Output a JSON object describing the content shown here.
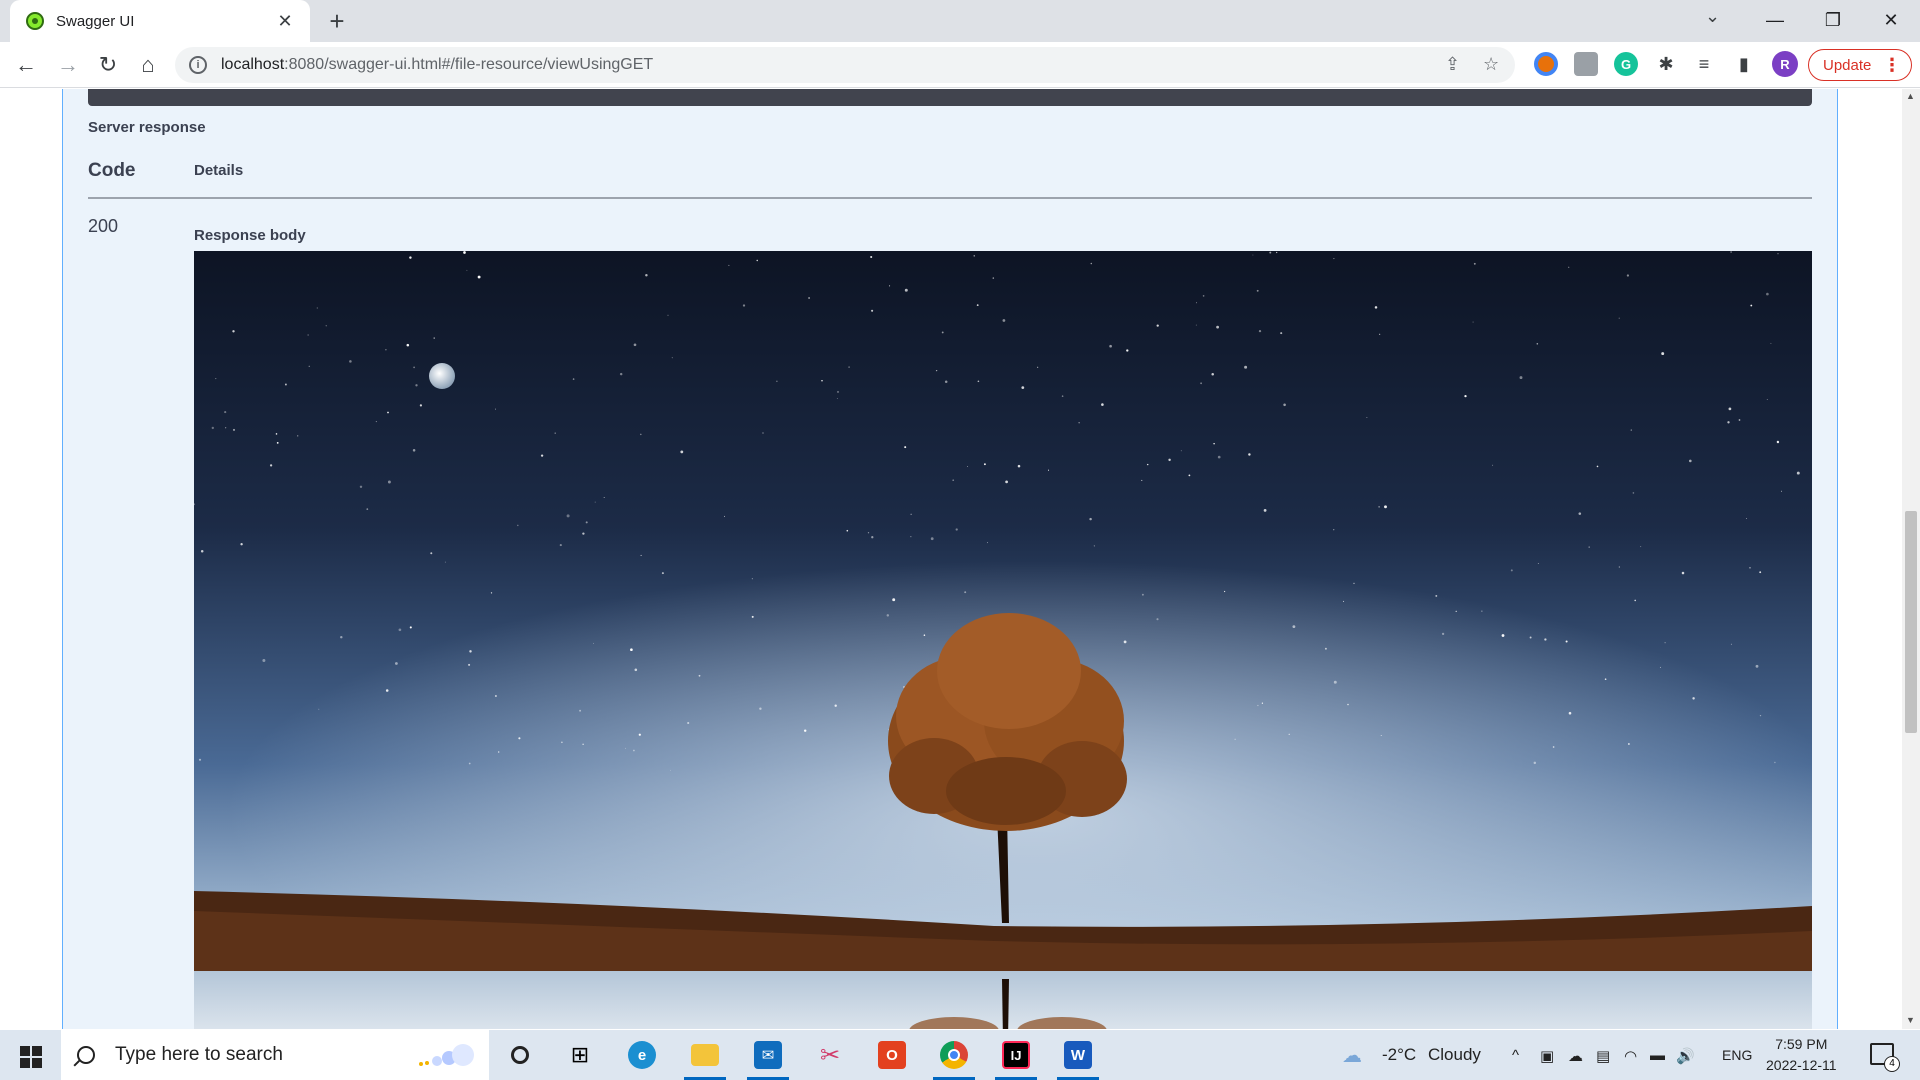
{
  "browser": {
    "tab_title": "Swagger UI",
    "tab_close": "✕",
    "new_tab": "+",
    "url_host": "localhost",
    "url_rest": ":8080/swagger-ui.html#/file-resource/viewUsingGET",
    "update_label": "Update",
    "profile_initial": "R",
    "icons": [
      "back-icon",
      "forward-icon",
      "reload-icon",
      "home-icon",
      "info-icon",
      "share-icon",
      "star-icon",
      "extension-icon",
      "reading-list-icon",
      "sidepanel-icon",
      "menu-icon"
    ]
  },
  "swagger": {
    "server_response_label": "Server response",
    "code_header": "Code",
    "details_header": "Details",
    "response_code": "200",
    "response_body_label": "Response body"
  },
  "taskbar": {
    "search_placeholder": "Type here to search",
    "weather_temp": "-2°C",
    "weather_desc": "Cloudy",
    "language": "ENG",
    "time": "7:59 PM",
    "date": "2022-12-11",
    "notification_count": "4"
  },
  "colors": {
    "opblock_bg": "#ebf3fb",
    "opblock_border": "#61affe",
    "text": "#3b4151",
    "update_red": "#d93025",
    "profile_purple": "#7b3fc4"
  }
}
